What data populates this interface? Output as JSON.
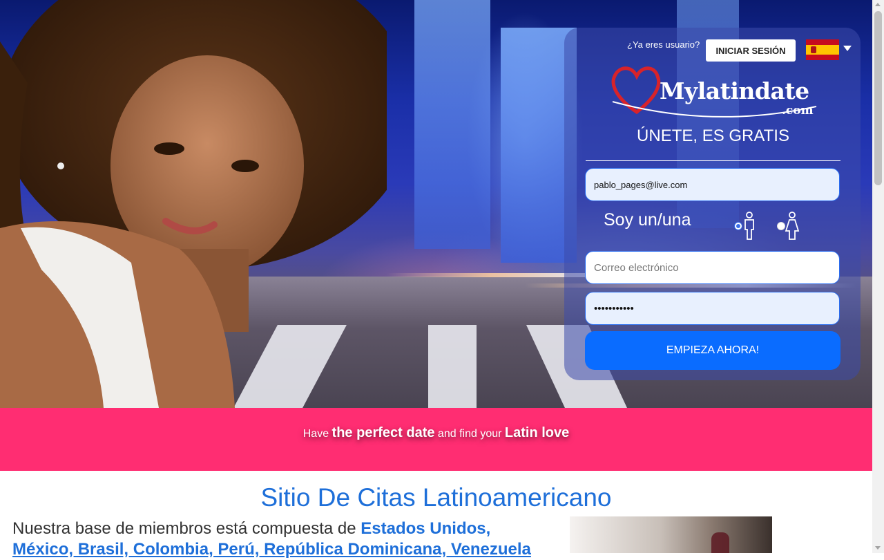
{
  "header": {
    "already_user": "¿Ya eres usuario?",
    "login_button": "INICIAR SESIÓN",
    "language_flag": "spain-flag-icon"
  },
  "brand": {
    "name": "Mylatindate",
    "tld": ".com",
    "heart_color": "#d8232a"
  },
  "signup": {
    "title": "ÚNETE, ES GRATIS",
    "email_autofill_value": "pablo_pages@live.com",
    "gender_label": "Soy un/una",
    "gender_options": [
      "male-icon",
      "female-icon"
    ],
    "selected_gender": "male",
    "email_placeholder": "Correo electrónico",
    "password_value": "•••••••••••",
    "submit_button": "EMPIEZA AHORA!"
  },
  "banner": {
    "pre": "Have ",
    "strong1": "the perfect date",
    "mid": " and find your ",
    "strong2": "Latin love"
  },
  "content": {
    "heading": "Sitio De Citas Latinoamericano",
    "intro": "Nuestra base de miembros está compuesta de ",
    "countries_line1": "Estados Unidos,",
    "countries_line2": "México, Brasil, Colombia, Perú, República Dominicana, Venezuela"
  },
  "colors": {
    "band": "#ff2d72",
    "accent_blue": "#1e6fd9",
    "cta": "#0a6cff"
  }
}
